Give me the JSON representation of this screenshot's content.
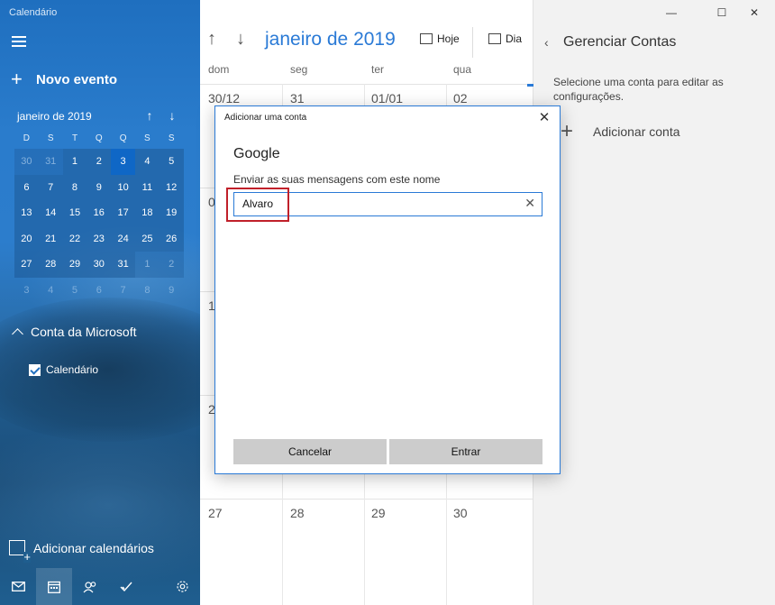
{
  "app": {
    "title": "Calendário"
  },
  "sidebar": {
    "new_event": "Novo evento",
    "mini_calendar": {
      "month": "janeiro de 2019",
      "weekdays": [
        "D",
        "S",
        "T",
        "Q",
        "Q",
        "S",
        "S"
      ],
      "weeks": [
        [
          "30",
          "31",
          "1",
          "2",
          "3",
          "4",
          "5"
        ],
        [
          "6",
          "7",
          "8",
          "9",
          "10",
          "11",
          "12"
        ],
        [
          "13",
          "14",
          "15",
          "16",
          "17",
          "18",
          "19"
        ],
        [
          "20",
          "21",
          "22",
          "23",
          "24",
          "25",
          "26"
        ],
        [
          "27",
          "28",
          "29",
          "30",
          "31",
          "1",
          "2"
        ],
        [
          "3",
          "4",
          "5",
          "6",
          "7",
          "8",
          "9"
        ]
      ],
      "selected": "3"
    },
    "account_section": "Conta da Microsoft",
    "calendar_item": "Calendário",
    "add_calendars": "Adicionar calendários"
  },
  "main": {
    "month_title": "janeiro de 2019",
    "today_label": "Hoje",
    "view_label": "Dia",
    "weekdays": [
      "dom",
      "seg",
      "ter",
      "qua"
    ],
    "first_row": [
      "30/12",
      "31",
      "01/01",
      "02"
    ],
    "partial_row_labels": [
      "0",
      "1",
      "2"
    ],
    "last_row": [
      "27",
      "28",
      "29",
      "30"
    ]
  },
  "right_panel": {
    "title": "Gerenciar Contas",
    "description": "Selecione uma conta para editar as configurações.",
    "add_account": "Adicionar conta"
  },
  "dialog": {
    "title": "Adicionar uma conta",
    "provider": "Google",
    "field_label": "Enviar as suas mensagens com este nome",
    "field_value": "Alvaro",
    "cancel": "Cancelar",
    "submit": "Entrar"
  },
  "colors": {
    "accent": "#2a7ad6",
    "highlight": "#c0202a",
    "selected_day": "#0f67c6"
  }
}
